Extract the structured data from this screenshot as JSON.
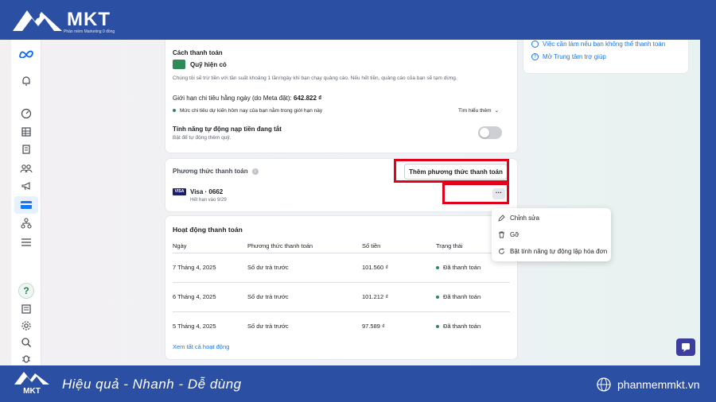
{
  "brand": {
    "name": "MKT",
    "tagline": "Phần mềm Marketing 0 đồng"
  },
  "left_rail": {
    "icons": [
      "meta-logo-icon",
      "bell-icon",
      "dashboard-gauge-icon",
      "table-icon",
      "pages-icon",
      "people-icon",
      "megaphone-icon",
      "billing-card-icon",
      "hierarchy-icon",
      "menu-lines-icon",
      "help-icon",
      "report-icon",
      "settings-gear-icon",
      "search-icon",
      "bug-icon"
    ],
    "help_label": "?"
  },
  "right_panel": {
    "link_1": "Việc cần làm nếu bạn không thể thanh toán",
    "link_2": "Mở Trung tâm trợ giúp"
  },
  "payment_method_card": {
    "title": "Cách thanh toán",
    "method_name": "Quỹ hiện có",
    "description": "Chúng tôi sẽ trừ tiền với tần suất khoảng 1 lần/ngày khi bạn chạy quảng cáo. Nếu hết tiền, quảng cáo của bạn sẽ tạm dừng.",
    "daily_limit_label": "Giới hạn chi tiêu hằng ngày (do Meta đặt):",
    "daily_limit_value": "642.822 ₫",
    "forecast_text": "Mức chi tiêu dự kiến hôm nay của bạn nằm trong giới hạn này",
    "learn_more": "Tìm hiểu thêm",
    "auto_topup_title": "Tính năng tự động nạp tiền đang tắt",
    "auto_topup_subtitle": "Bật để tự động thêm quỹ.",
    "auto_topup_enabled": false
  },
  "payment_methods": {
    "title": "Phương thức thanh toán",
    "add_button": "Thêm phương thức thanh toán",
    "card_brand": "VISA",
    "card_name": "Visa · 0662",
    "card_expiry": "Hết hạn vào 9/29",
    "more_button": "···"
  },
  "context_menu": {
    "items": [
      {
        "label": "Chỉnh sửa",
        "icon": "pencil-icon"
      },
      {
        "label": "Gỡ",
        "icon": "trash-icon"
      },
      {
        "label": "Bật tính năng tự động lập hóa đơn",
        "icon": "refresh-icon"
      }
    ]
  },
  "activity": {
    "title": "Hoạt động thanh toán",
    "columns": [
      "Ngày",
      "Phương thức thanh toán",
      "Số tiền",
      "Trạng thái"
    ],
    "rows": [
      {
        "date": "7 Tháng 4, 2025",
        "method": "Số dư trả trước",
        "amount": "101.560 ₫",
        "status": "Đã thanh toán"
      },
      {
        "date": "6 Tháng 4, 2025",
        "method": "Số dư trả trước",
        "amount": "101.212 ₫",
        "status": "Đã thanh toán"
      },
      {
        "date": "5 Tháng 4, 2025",
        "method": "Số dư trả trước",
        "amount": "97.589 ₫",
        "status": "Đã thanh toán"
      }
    ],
    "see_all": "Xem tất cả hoạt động"
  },
  "banner": {
    "slogan": "Hiệu quả - Nhanh  - Dễ dùng",
    "website": "phanmemmkt.vn"
  },
  "colors": {
    "brand_blue": "#2a4fa3",
    "highlight_red": "#e3001b",
    "success_green": "#2e8b57",
    "link_blue": "#1877f2"
  }
}
